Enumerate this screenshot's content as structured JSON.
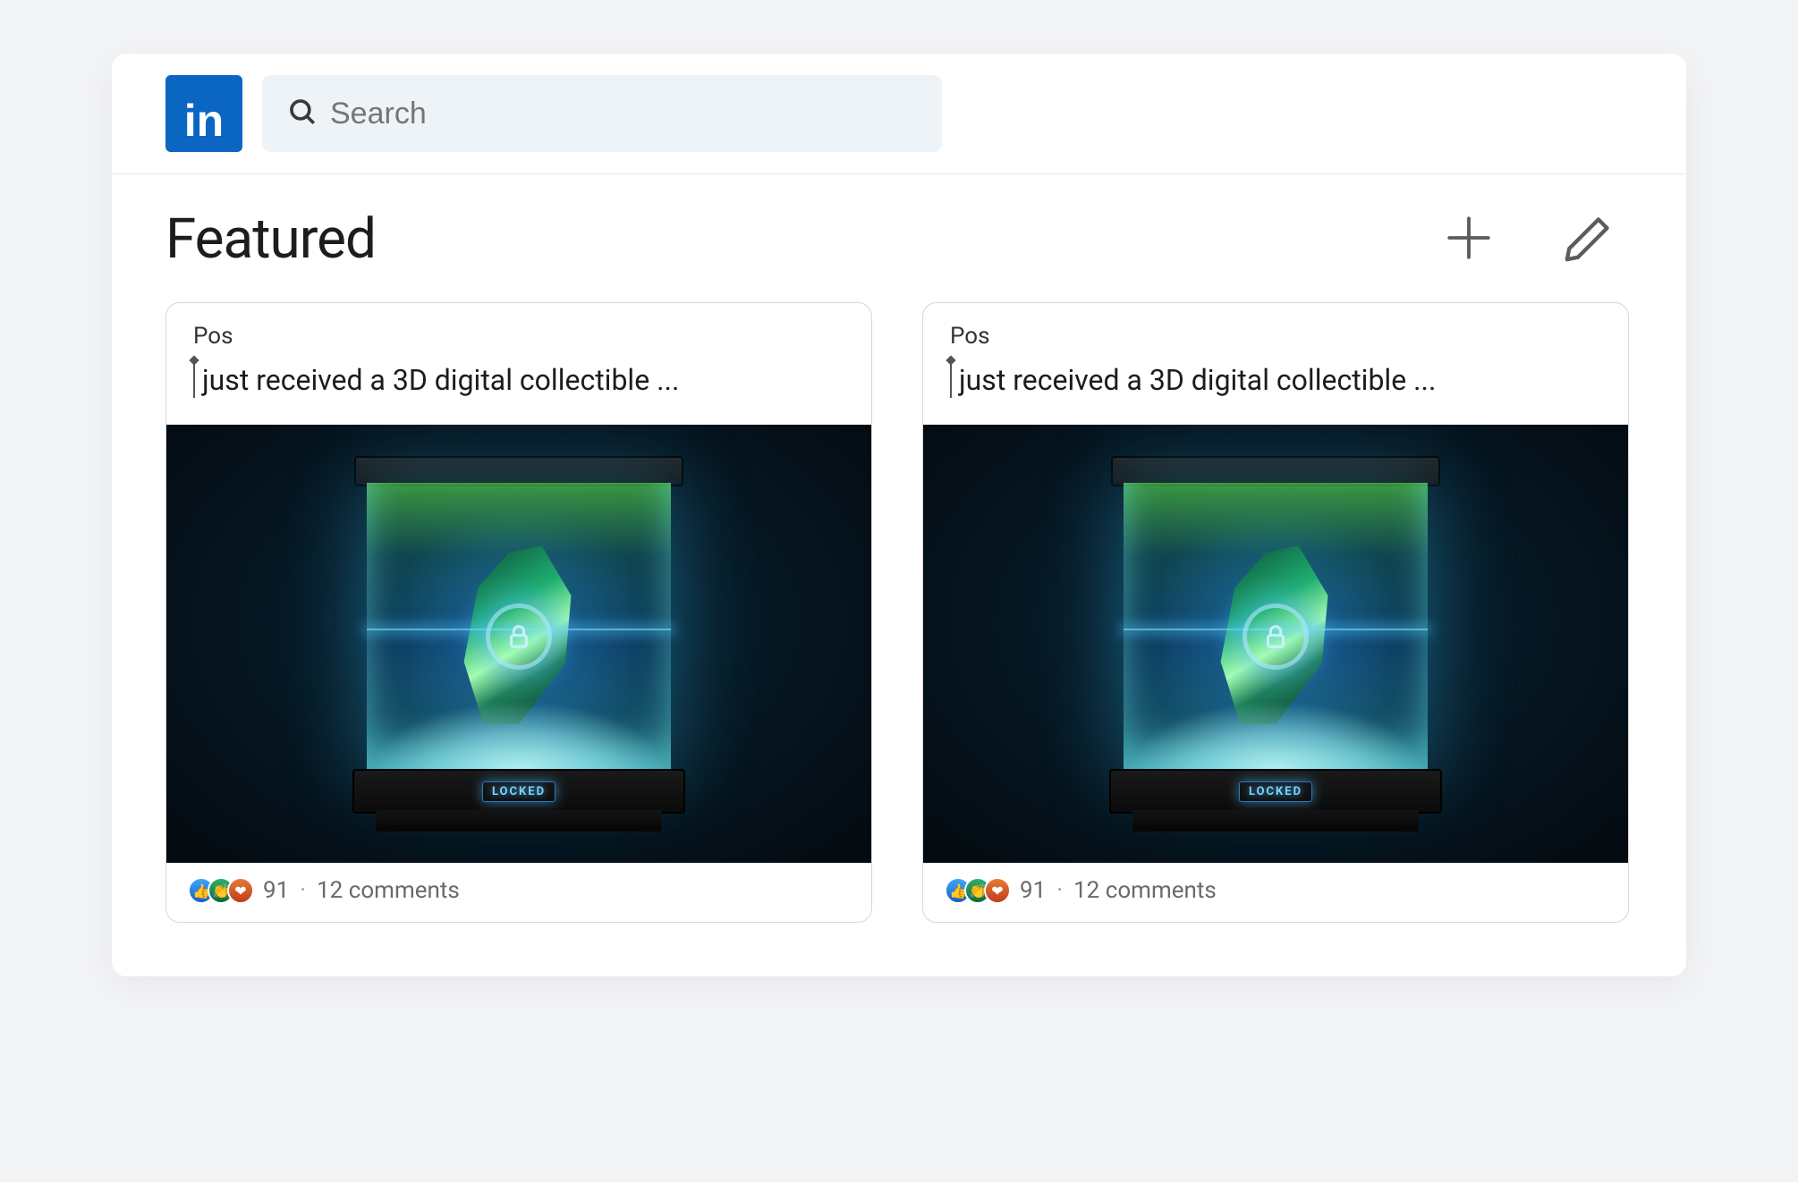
{
  "brand": {
    "logo_text": "in"
  },
  "search": {
    "placeholder": "Search"
  },
  "section": {
    "title": "Featured"
  },
  "cards": [
    {
      "type_label": "Pos",
      "title": "just received a 3D digital collectible ...",
      "locked_label": "LOCKED",
      "reaction_count": "91",
      "comments_label": "12 comments"
    },
    {
      "type_label": "Pos",
      "title": "just received a 3D digital collectible ...",
      "locked_label": "LOCKED",
      "reaction_count": "91",
      "comments_label": "12 comments"
    }
  ]
}
